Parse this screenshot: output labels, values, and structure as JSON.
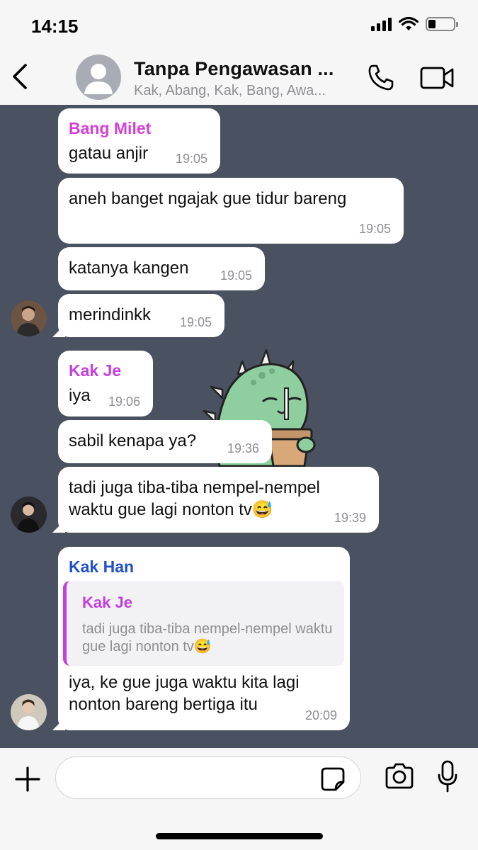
{
  "status_bar": {
    "time": "14:15"
  },
  "header": {
    "title": "Tanpa Pengawasan ...",
    "subtitle": "Kak, Abang, Kak, Bang, Awa..."
  },
  "messages": [
    {
      "sender": "Bang Milet",
      "sender_color": "#d63fd6",
      "text": "gatau anjir",
      "time": "19:05"
    },
    {
      "text": "aneh banget ngajak gue tidur bareng",
      "time": "19:05"
    },
    {
      "text": "katanya kangen",
      "time": "19:05"
    },
    {
      "text": "merindinkk",
      "time": "19:05"
    },
    {
      "sender": "Kak Je",
      "sender_color": "#c43fe0",
      "text": "iya",
      "time": "19:06"
    },
    {
      "text": "sabil kenapa ya?",
      "time": "19:36"
    },
    {
      "text": "tadi juga tiba-tiba nempel-nempel waktu gue lagi nonton tv😅",
      "time": "19:39"
    },
    {
      "sender": "Kak Han",
      "sender_color": "#1f4fc9",
      "quote": {
        "sender": "Kak Je",
        "text": "tadi juga tiba-tiba nempel-nempel waktu gue lagi nonton tv😅"
      },
      "text": "iya, ke gue juga waktu kita lagi nonton bareng bertiga itu",
      "time": "20:09"
    }
  ],
  "input": {
    "placeholder": ""
  },
  "colors": {
    "chat_background": "#4a5160",
    "bubble": "#ffffff",
    "bar": "#f6f6f6"
  }
}
